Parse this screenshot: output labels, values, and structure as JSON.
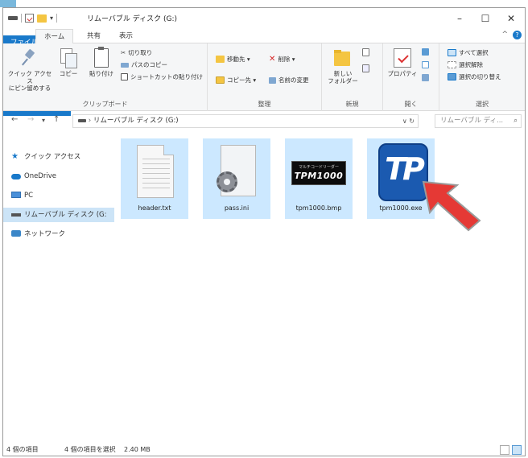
{
  "window": {
    "title": "リムーバブル ディスク (G:)",
    "controls": {
      "minimize": "–",
      "maximize": "☐",
      "close": "✕"
    }
  },
  "ribbon_tabs": [
    "ファイル",
    "ホーム",
    "共有",
    "表示"
  ],
  "ribbon": {
    "clipboard": {
      "pin_label_1": "クイック アクセス",
      "pin_label_2": "にピン留めする",
      "copy": "コピー",
      "paste": "貼り付け",
      "cut": "切り取り",
      "copy_path": "パスのコピー",
      "paste_shortcut": "ショートカットの貼り付け",
      "group": "クリップボード"
    },
    "organize": {
      "move_to": "移動先 ▾",
      "delete": "削除 ▾",
      "copy_to": "コピー先 ▾",
      "rename": "名前の変更",
      "group": "整理"
    },
    "new": {
      "new_folder_1": "新しい",
      "new_folder_2": "フォルダー",
      "group": "新規"
    },
    "open": {
      "properties": "プロパティ",
      "group": "開く"
    },
    "select": {
      "select_all": "すべて選択",
      "select_none": "選択解除",
      "invert": "選択の切り替え",
      "group": "選択"
    }
  },
  "address": {
    "path": "リムーバブル ディスク (G:)",
    "search_placeholder": "リムーバブル ディ..."
  },
  "nav_pane": [
    {
      "label": "クイック アクセス",
      "icon": "star-icon",
      "color": "#1979ca"
    },
    {
      "label": "OneDrive",
      "icon": "cloud-icon",
      "color": "#1979ca"
    },
    {
      "label": "PC",
      "icon": "monitor-icon",
      "color": "#4a90d9"
    },
    {
      "label": "リムーバブル ディスク (G:",
      "icon": "drive-icon",
      "color": "#555555"
    },
    {
      "label": "ネットワーク",
      "icon": "network-icon",
      "color": "#3a86c8"
    }
  ],
  "files": [
    {
      "name": "header.txt",
      "icon": "text-file-icon"
    },
    {
      "name": "pass.ini",
      "icon": "settings-file-icon"
    },
    {
      "name": "tpm1000.bmp",
      "icon": "bitmap-file-icon",
      "thumb_sub": "マルチコードリーダー",
      "thumb_big": "TPM1000"
    },
    {
      "name": "tpm1000.exe",
      "icon": "app-exe-icon",
      "thumb_big": "TP"
    }
  ],
  "status": {
    "item_count": "4 個の項目",
    "selected": "4 個の項目を選択",
    "size": "2.40 MB"
  },
  "colors": {
    "accent": "#1979ca",
    "selection": "#cce8ff",
    "arrow": "#e53935"
  }
}
